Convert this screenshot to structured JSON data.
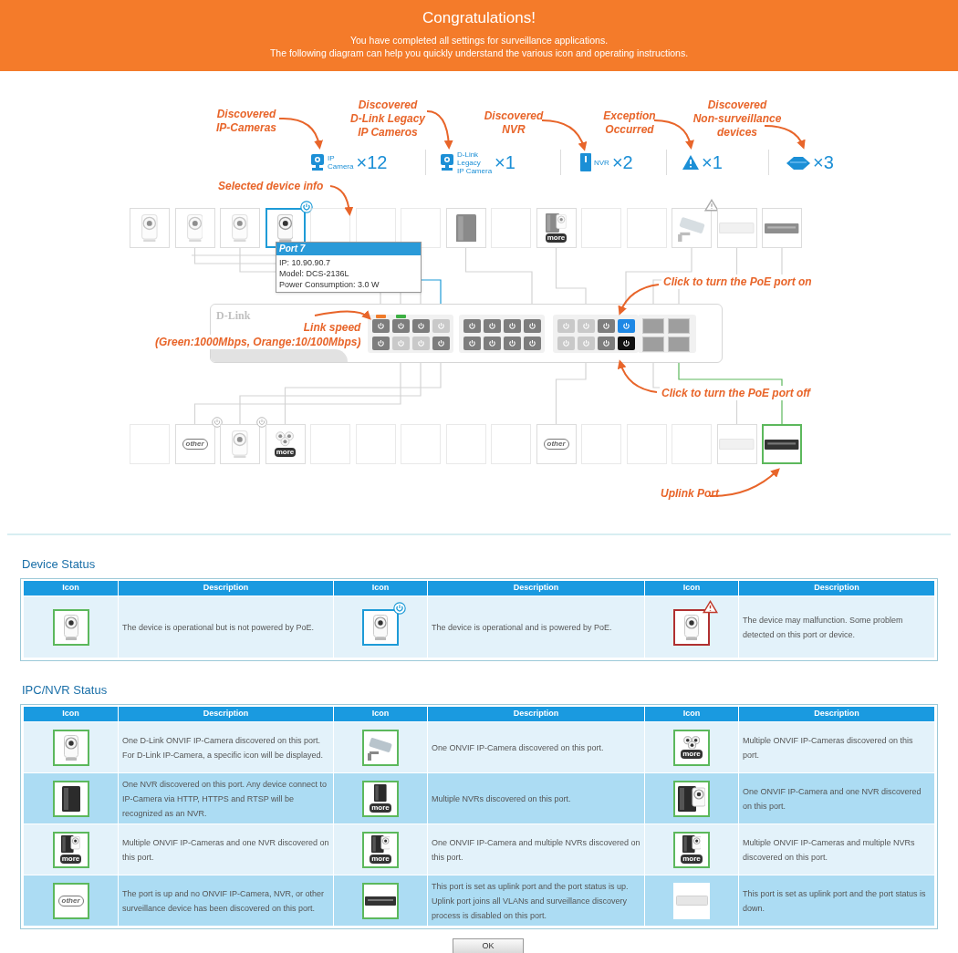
{
  "banner": {
    "title": "Congratulations!",
    "lines": [
      "You have completed all settings for surveillance applications.",
      "The following diagram can help you quickly understand the various icon and operating instructions."
    ]
  },
  "legend": [
    {
      "caption": [
        "Discovered",
        "IP-Cameras"
      ],
      "kind": "camera",
      "icon_label": [
        "IP",
        "Camera"
      ],
      "count": "×12"
    },
    {
      "caption": [
        "Discovered",
        "D-Link Legacy",
        "IP Cameros"
      ],
      "kind": "camera",
      "icon_label": [
        "D-Link",
        "Legacy",
        "IP Camera"
      ],
      "count": "×1"
    },
    {
      "caption": [
        "Discovered",
        "NVR"
      ],
      "kind": "nvr",
      "icon_label": [
        "NVR"
      ],
      "count": "×2"
    },
    {
      "caption": [
        "Exception",
        "Occurred"
      ],
      "kind": "warning",
      "count": "×1"
    },
    {
      "caption": [
        "Discovered",
        "Non-surveillance",
        "devices"
      ],
      "kind": "device",
      "count": "×3"
    }
  ],
  "annotations": [
    {
      "lines": [
        "Selected device info"
      ]
    },
    {
      "lines": [
        "Click to turn the PoE port on"
      ]
    },
    {
      "lines": [
        "Link speed",
        "(Green:1000Mbps, Orange:10/100Mbps)"
      ]
    },
    {
      "lines": [
        "Click to turn the PoE port off"
      ]
    },
    {
      "lines": [
        "Uplink Port"
      ]
    }
  ],
  "switch": {
    "logo": "D-Link",
    "top_ports": [
      {
        "kind": "gray",
        "color": "#f07b2a"
      },
      {
        "kind": "gray",
        "color": "#3cb043"
      },
      {
        "kind": "gray"
      },
      {
        "kind": "light"
      },
      {
        "kind": "gray"
      },
      {
        "kind": "gray"
      },
      {
        "kind": "gray"
      },
      {
        "kind": "gray"
      },
      {
        "kind": "light"
      },
      {
        "kind": "light"
      },
      {
        "kind": "gray"
      },
      {
        "kind": "blue"
      }
    ],
    "bottom_ports": [
      {
        "kind": "gray"
      },
      {
        "kind": "light"
      },
      {
        "kind": "light"
      },
      {
        "kind": "gray"
      },
      {
        "kind": "gray"
      },
      {
        "kind": "gray"
      },
      {
        "kind": "gray"
      },
      {
        "kind": "gray"
      },
      {
        "kind": "light"
      },
      {
        "kind": "light"
      },
      {
        "kind": "gray"
      },
      {
        "kind": "black"
      }
    ]
  },
  "tooltip": {
    "title": "Port 7",
    "lines": [
      "IP: 10.90.90.7",
      "Model: DCS-2136L",
      "Power Consumption: 3.0 W"
    ]
  },
  "top_devices": [
    {
      "kind": "camera",
      "selected": false,
      "poe": false,
      "warning": false,
      "connected": false
    },
    {
      "kind": "camera",
      "selected": false,
      "poe": false,
      "warning": false,
      "connected": false
    },
    {
      "kind": "camera",
      "selected": false,
      "poe": false,
      "warning": false,
      "connected": false
    },
    {
      "kind": "camera",
      "selected": true,
      "poe": true,
      "warning": false,
      "connected": false
    },
    {
      "kind": "empty",
      "selected": false,
      "poe": false,
      "warning": false,
      "connected": false
    },
    {
      "kind": "empty",
      "selected": false,
      "poe": false,
      "warning": false,
      "connected": false
    },
    {
      "kind": "empty",
      "selected": false,
      "poe": false,
      "warning": false,
      "connected": false
    },
    {
      "kind": "nvr",
      "selected": false,
      "poe": false,
      "warning": false,
      "connected": false
    },
    {
      "kind": "empty",
      "selected": false,
      "poe": false,
      "warning": false,
      "connected": false
    },
    {
      "kind": "nvr-camera",
      "selected": false,
      "poe": false,
      "warning": false,
      "connected": false,
      "badge": "more"
    },
    {
      "kind": "empty",
      "selected": false,
      "poe": false,
      "warning": false,
      "connected": false
    },
    {
      "kind": "empty",
      "selected": false,
      "poe": false,
      "warning": false,
      "connected": false
    },
    {
      "kind": "ipcam",
      "selected": false,
      "poe": false,
      "warning": true,
      "connected": false
    },
    {
      "kind": "switch-down",
      "selected": false,
      "poe": false,
      "warning": false,
      "connected": false
    },
    {
      "kind": "switch-up",
      "selected": false,
      "poe": false,
      "warning": false,
      "connected": false
    }
  ],
  "bottom_devices": [
    {
      "kind": "empty",
      "selected": false,
      "poe": false,
      "warning": false,
      "connected": false
    },
    {
      "kind": "other",
      "selected": false,
      "poe": true,
      "warning": false,
      "connected": false,
      "badge": "other"
    },
    {
      "kind": "camera",
      "selected": false,
      "poe": true,
      "warning": false,
      "connected": false
    },
    {
      "kind": "cameras",
      "selected": false,
      "poe": false,
      "warning": false,
      "connected": false,
      "badge": "more"
    },
    {
      "kind": "empty",
      "selected": false,
      "poe": false,
      "warning": false,
      "connected": false
    },
    {
      "kind": "empty",
      "selected": false,
      "poe": false,
      "warning": false,
      "connected": false
    },
    {
      "kind": "empty",
      "selected": false,
      "poe": false,
      "warning": false,
      "connected": false
    },
    {
      "kind": "empty",
      "selected": false,
      "poe": false,
      "warning": false,
      "connected": false
    },
    {
      "kind": "empty",
      "selected": false,
      "poe": false,
      "warning": false,
      "connected": false
    },
    {
      "kind": "other",
      "selected": false,
      "poe": false,
      "warning": false,
      "connected": false,
      "badge": "other"
    },
    {
      "kind": "empty",
      "selected": false,
      "poe": false,
      "warning": false,
      "connected": false
    },
    {
      "kind": "empty",
      "selected": false,
      "poe": false,
      "warning": false,
      "connected": false
    },
    {
      "kind": "empty",
      "selected": false,
      "poe": false,
      "warning": false,
      "connected": false
    },
    {
      "kind": "switch-down",
      "selected": false,
      "poe": false,
      "warning": false,
      "connected": false
    },
    {
      "kind": "switch-up",
      "selected": false,
      "poe": false,
      "warning": false,
      "connected": true
    }
  ],
  "device_status": {
    "title": "Device Status",
    "columns": [
      {
        "icon": "Icon",
        "description": "Description"
      },
      {
        "icon": "Icon",
        "description": "Description"
      },
      {
        "icon": "Icon",
        "description": "Description"
      }
    ],
    "rows": [
      [
        {
          "icon": {
            "kind": "camera",
            "powered": false,
            "warning": false
          },
          "description": "The device is operational but is not powered by PoE."
        },
        {
          "icon": {
            "kind": "camera",
            "powered": true,
            "warning": false
          },
          "description": "The device is operational and is powered by PoE."
        },
        {
          "icon": {
            "kind": "camera",
            "powered": false,
            "warning": true
          },
          "description": "The device may malfunction. Some problem detected on this port or device."
        }
      ]
    ]
  },
  "ipc_nvr_status": {
    "title": "IPC/NVR Status",
    "columns": [
      {
        "icon": "Icon",
        "description": "Description"
      },
      {
        "icon": "Icon",
        "description": "Description"
      },
      {
        "icon": "Icon",
        "description": "Description"
      }
    ],
    "rows": [
      [
        {
          "icon": {
            "kind": "camera",
            "powered": false,
            "warning": false
          },
          "description": "One D-Link ONVIF IP-Camera discovered on this port. For D-Link IP-Camera, a specific icon will be displayed."
        },
        {
          "icon": {
            "kind": "ipcam",
            "powered": false,
            "warning": false
          },
          "description": "One ONVIF IP-Camera discovered on this port."
        },
        {
          "icon": {
            "kind": "cameras",
            "powered": false,
            "warning": false,
            "badge": "more"
          },
          "description": "Multiple ONVIF IP-Cameras discovered on this port."
        }
      ],
      [
        {
          "icon": {
            "kind": "nvr",
            "powered": false,
            "warning": false
          },
          "description": "One NVR discovered on this port. Any device connect to IP-Camera via HTTP, HTTPS and RTSP will be recognized as an NVR."
        },
        {
          "icon": {
            "kind": "nvr",
            "powered": false,
            "warning": false,
            "badge": "more"
          },
          "description": "Multiple NVRs discovered on this port."
        },
        {
          "icon": {
            "kind": "nvr-camera",
            "powered": false,
            "warning": false
          },
          "description": "One ONVIF IP-Camera and one NVR discovered on this port."
        }
      ],
      [
        {
          "icon": {
            "kind": "nvr-camera",
            "powered": false,
            "warning": false,
            "badge": "more"
          },
          "description": "Multiple ONVIF IP-Cameras and one NVR discovered on this port."
        },
        {
          "icon": {
            "kind": "nvr-camera",
            "powered": false,
            "warning": false,
            "badge": "more"
          },
          "description": "One ONVIF IP-Camera and multiple NVRs discovered on this port."
        },
        {
          "icon": {
            "kind": "nvr-camera",
            "powered": false,
            "warning": false,
            "badge": "more"
          },
          "description": "Multiple ONVIF IP-Cameras and multiple NVRs discovered on this port."
        }
      ],
      [
        {
          "icon": {
            "kind": "other",
            "powered": false,
            "warning": false,
            "badge": "other"
          },
          "description": "The port is up and no ONVIF IP-Camera, NVR, or other surveillance device has been discovered on this port."
        },
        {
          "icon": {
            "kind": "switch-up",
            "powered": false,
            "warning": false
          },
          "description": "This port is set as uplink port and the port status is up. Uplink port joins all VLANs and surveillance discovery process is disabled on this port."
        },
        {
          "icon": {
            "kind": "switch-down",
            "powered": false,
            "warning": false
          },
          "description": "This port is set as uplink port and the port status is down."
        }
      ]
    ]
  },
  "ok_button": "OK"
}
